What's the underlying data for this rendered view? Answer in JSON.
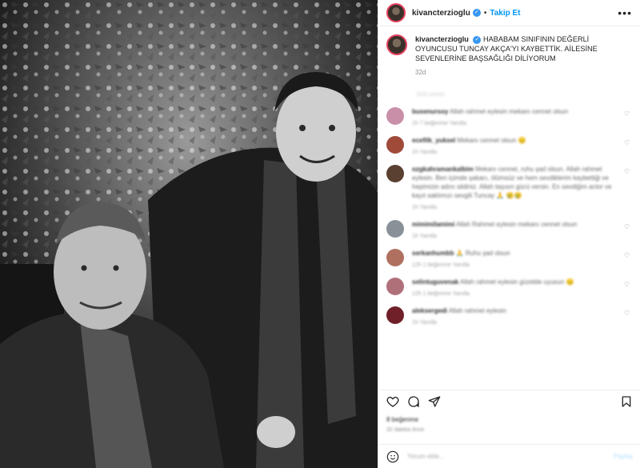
{
  "post": {
    "username": "kivancterzioglu",
    "follow_label": "Takip Et",
    "more_label": "•••",
    "dot": "•",
    "verified_mark": "✓",
    "caption": "HABABAM SINIFININ DEĞERLİ OYUNCUSU TUNCAY AKÇA'YI KAYBETTİK. AİLESİNE SEVENLERİNE BAŞSAĞLIĞI DİLİYORUM",
    "time": "32d"
  },
  "comments": [
    {
      "user": "busenursoy",
      "text": "Allah rahmet eylesin mekanı cennet olsun",
      "meta": "1h   7 beğenme   Yanıtla",
      "avatar_color": "#c98fa8"
    },
    {
      "user": "ecefilk_yuksel",
      "text": "Mekanı cennet olsun 😔",
      "meta": "1h   Yanıtla",
      "avatar_color": "#a04a3a"
    },
    {
      "user": "ozgkahramankalbim",
      "text": "Mekanı cennet, ruhu şad olsun. Allah rahmet eylesin. Ben içimde şakacı, ölümsüz ve hem sevdiklerim kaybettiği ve hepimizin adını sildiniz. Allah taşısın gücü versin. En sevdiğim actor ve kayıt saklımızı sevgili Tuncay 🙏 😢😢",
      "meta": "1h   Yanıtla",
      "avatar_color": "#5a4030"
    },
    {
      "user": "mimimilamimi",
      "text": "Allah Rahmet eylesin mekanı cennet olsun",
      "meta": "1h   Yanıtla",
      "avatar_color": "#8a9098"
    },
    {
      "user": "serkanhumbb",
      "text": "🙏 Ruhu şad olsun",
      "meta": "12h   1 beğenme   Yanıtla",
      "avatar_color": "#b07060"
    },
    {
      "user": "selintuguvenak",
      "text": "Allah rahmet eylesin güzelde uyusun 😔",
      "meta": "12h   1 beğenme   Yanıtla",
      "avatar_color": "#b0707a"
    },
    {
      "user": "aleksergedi",
      "text": "Allah rahmet eylesin",
      "meta": "1h   Yanıtla",
      "avatar_color": "#702028"
    }
  ],
  "view_hidden": "Gizli yorum",
  "likes": "8 beğenme",
  "likes_sub": "32 dakika önce",
  "add_comment": {
    "placeholder": "Yorum ekle...",
    "post_label": "Paylaş"
  },
  "icons": {
    "like": "heart-icon",
    "comment": "comment-icon",
    "share": "share-icon",
    "save": "bookmark-icon",
    "emoji": "emoji-icon"
  },
  "colors": {
    "accent": "#0095f6",
    "story_ring": "#e4405f",
    "verified": "#3897f0"
  }
}
